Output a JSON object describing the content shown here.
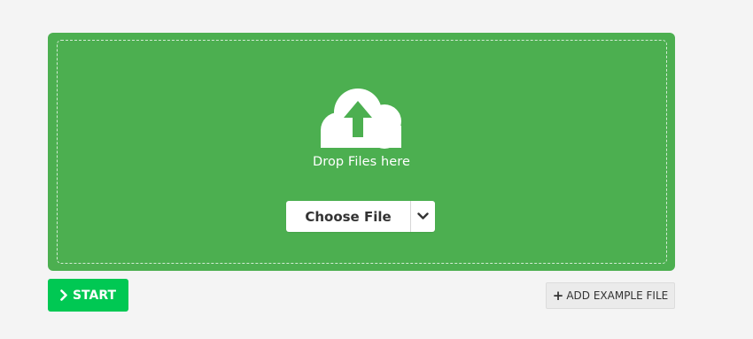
{
  "dropzone": {
    "drop_text": "Drop Files here",
    "icon": "cloud-upload-icon"
  },
  "choose_file": {
    "label": "Choose File",
    "caret_icon": "chevron-down-icon"
  },
  "start": {
    "label": "START",
    "icon": "chevron-right-icon"
  },
  "example": {
    "icon": "plus-icon",
    "label": "ADD EXAMPLE FILE"
  },
  "colors": {
    "dropzone_bg": "#4caf50",
    "start_bg": "#00c853",
    "page_bg": "#f4f4f4"
  }
}
